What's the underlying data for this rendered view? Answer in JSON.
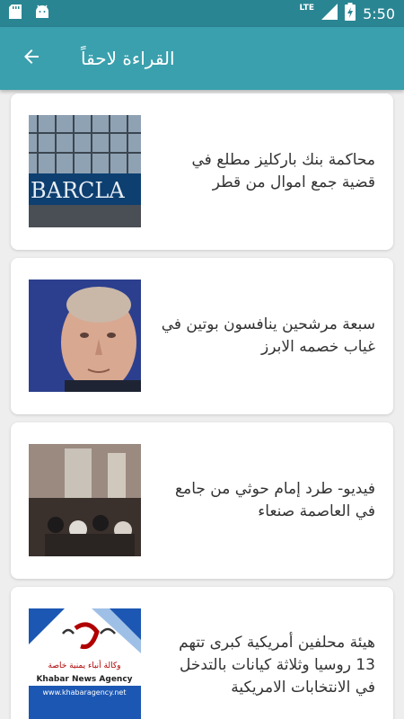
{
  "status_bar": {
    "time": "5:50",
    "network": "LTE"
  },
  "app_bar": {
    "title": "القراءة لاحقاً",
    "back_icon": "arrow-back-icon"
  },
  "articles": [
    {
      "title": "محاكمة بنك باركليز مطلع في قضية جمع اموال من قطر",
      "thumb_text": "BARCLA"
    },
    {
      "title": "سبعة مرشحين ينافسون بوتين في غياب خصمه الابرز"
    },
    {
      "title": "فيديو- طرد إمام حوثي من جامع في العاصمة صنعاء"
    },
    {
      "title": "هيئة محلفين أمريكية كبرى تتهم 13 روسيا وثلاثة كيانات بالتدخل في الانتخابات الامريكية",
      "logo_subtitle": "وكالة أنباء يمنية خاصة",
      "logo_name": "Khabar News Agency",
      "logo_url": "www.khabaragency.net"
    }
  ],
  "colors": {
    "status_bar": "#2a8593",
    "app_bar": "#3aa0ad",
    "background": "#eeeeee"
  }
}
